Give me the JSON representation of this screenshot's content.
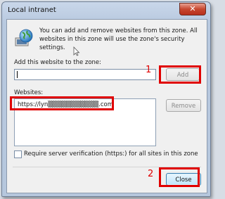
{
  "window": {
    "title": "Local intranet",
    "close_glyph": "✕"
  },
  "description": "You can add and remove websites from this zone. All websites in this zone will use the zone's security settings.",
  "add_section": {
    "label": "Add this website to the zone:",
    "input_value": "",
    "add_button": "Add"
  },
  "websites": {
    "label": "Websites:",
    "items": [
      "https://lyn▒▒▒▒▒▒▒▒▒▒▒.com"
    ],
    "remove_button": "Remove"
  },
  "require_verification": {
    "label": "Require server verification (https:) for all sites in this zone",
    "checked": false
  },
  "close_button": "Close",
  "annotations": {
    "step1": "1",
    "step2": "2",
    "color": "#e00000"
  },
  "icons": [
    "globe-icon",
    "close-icon",
    "mouse-cursor-icon"
  ]
}
